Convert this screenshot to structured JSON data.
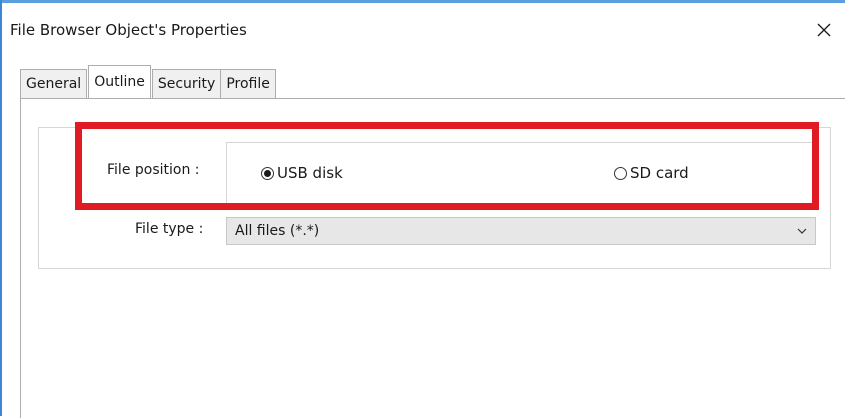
{
  "window": {
    "title": "File Browser Object's Properties",
    "close_icon": "close-icon"
  },
  "tabs": [
    {
      "label": "General",
      "active": false
    },
    {
      "label": "Outline",
      "active": true
    },
    {
      "label": "Security",
      "active": false
    },
    {
      "label": "Profile",
      "active": false
    }
  ],
  "form": {
    "file_position_label": "File position :",
    "file_position_options": [
      {
        "label": "USB disk",
        "selected": true
      },
      {
        "label": "SD card",
        "selected": false
      }
    ],
    "file_type_label": "File type :",
    "file_type_value": "All files (*.*)"
  },
  "colors": {
    "highlight": "#e01b24",
    "window_border": "#3d86d4"
  }
}
